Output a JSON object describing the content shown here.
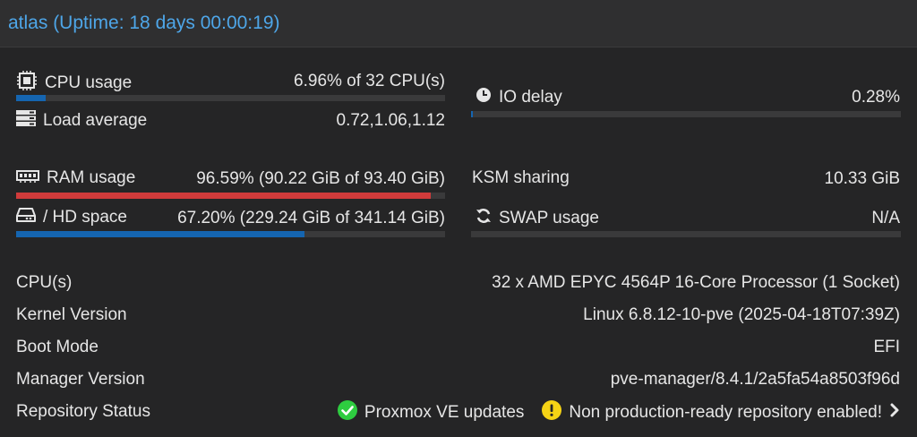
{
  "header": {
    "title": "atlas (Uptime: 18 days 00:00:19)"
  },
  "stats": {
    "cpu": {
      "label": "CPU usage",
      "value": "6.96% of 32 CPU(s)",
      "fraction": 0.0696
    },
    "load": {
      "label": "Load average",
      "value": "0.72,1.06,1.12"
    },
    "io": {
      "label": "IO delay",
      "value": "0.28%",
      "fraction": 0.0028
    },
    "ram": {
      "label": "RAM usage",
      "value": "96.59% (90.22 GiB of 93.40 GiB)",
      "fraction": 0.9659
    },
    "ksm": {
      "label": "KSM sharing",
      "value": "10.33 GiB"
    },
    "hd": {
      "label": "/ HD space",
      "value": "67.20% (229.24 GiB of 341.14 GiB)",
      "fraction": 0.672
    },
    "swap": {
      "label": "SWAP usage",
      "value": "N/A",
      "fraction": 0
    }
  },
  "info": {
    "cpus": {
      "label": "CPU(s)",
      "value": "32 x AMD EPYC 4564P 16-Core Processor (1 Socket)"
    },
    "kernel": {
      "label": "Kernel Version",
      "value": "Linux 6.8.12-10-pve (2025-04-18T07:39Z)"
    },
    "boot": {
      "label": "Boot Mode",
      "value": "EFI"
    },
    "manager": {
      "label": "Manager Version",
      "value": "pve-manager/8.4.1/2a5fa54a8503f96d"
    },
    "repo": {
      "label": "Repository Status",
      "ok_text": "Proxmox VE updates",
      "warn_text": "Non production-ready repository enabled!"
    }
  },
  "colors": {
    "accent": "#4ea6e8",
    "bar_blue": "#1565b0",
    "bar_red": "#d03b3b",
    "ok": "#2ecc40",
    "warn": "#f5d315"
  },
  "icons": {
    "cpu": "chip-icon",
    "load": "server-stack-icon",
    "io": "clock-icon",
    "ram": "memory-icon",
    "hd": "hdd-icon",
    "swap": "refresh-icon",
    "ok": "check-circle-icon",
    "warn": "exclamation-circle-icon",
    "more": "chevron-right-icon"
  }
}
